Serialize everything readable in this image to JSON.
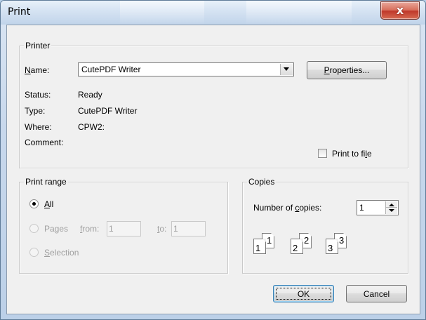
{
  "window": {
    "title": "Print",
    "close_glyph": "x"
  },
  "printer": {
    "legend": "Printer",
    "name_label_pre": "",
    "name_label_u": "N",
    "name_label_post": "ame:",
    "name_value": "CutePDF Writer",
    "properties_pre": "",
    "properties_u": "P",
    "properties_post": "roperties...",
    "status_label": "Status:",
    "status_value": "Ready",
    "type_label": "Type:",
    "type_value": "CutePDF Writer",
    "where_label": "Where:",
    "where_value": "CPW2:",
    "comment_label": "Comment:",
    "print_to_file_pre": "Print to fi",
    "print_to_file_u": "l",
    "print_to_file_post": "e"
  },
  "print_range": {
    "legend": "Print range",
    "all_u": "A",
    "all_post": "ll",
    "pages_label": "Pages",
    "from_u": "f",
    "from_post": "rom:",
    "from_value": "1",
    "to_u": "t",
    "to_post": "o:",
    "to_value": "1",
    "selection_u": "S",
    "selection_post": "election"
  },
  "copies": {
    "legend": "Copies",
    "number_pre": "Number of ",
    "number_u": "c",
    "number_post": "opies:",
    "number_value": "1",
    "collate_pages": [
      "1",
      "1",
      "2",
      "2",
      "3",
      "3"
    ]
  },
  "buttons": {
    "ok": "OK",
    "cancel": "Cancel"
  }
}
